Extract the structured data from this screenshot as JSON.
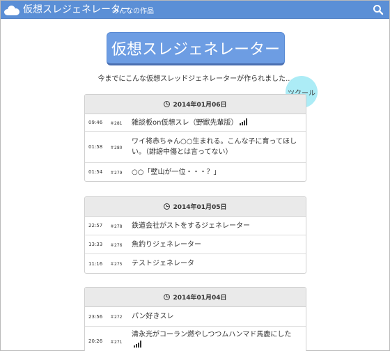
{
  "nav": {
    "brand": "仮想スレジェネレーター",
    "link": "みんなの作品"
  },
  "hero": {
    "button_label": "仮想スレジェネレーター",
    "subtitle": "今までにこんな仮想スレッドジェネレーターが作られました...",
    "create_label": "ツクール"
  },
  "panels": [
    {
      "date": "2014年01月06日",
      "rows": [
        {
          "time": "09:46",
          "num": "＃281",
          "title": "雑談板on仮想スレ（野獣先輩版）",
          "signal": true
        },
        {
          "time": "01:58",
          "num": "＃280",
          "title": "ワイ将赤ちゃん○○生まれる。こんな子に育ってほしい。（誹謗中傷とは言ってない）",
          "signal": false
        },
        {
          "time": "01:54",
          "num": "＃279",
          "title": "○○「壁山が一位・・・？」",
          "signal": false
        }
      ]
    },
    {
      "date": "2014年01月05日",
      "rows": [
        {
          "time": "22:57",
          "num": "＃278",
          "title": "鉄道会社がストをするジェネレーター",
          "signal": false
        },
        {
          "time": "13:33",
          "num": "＃276",
          "title": "魚釣りジェネレーター",
          "signal": false
        },
        {
          "time": "11:16",
          "num": "＃275",
          "title": "テストジェネレータ",
          "signal": false
        }
      ]
    },
    {
      "date": "2014年01月04日",
      "rows": [
        {
          "time": "23:56",
          "num": "＃272",
          "title": "パン好きスレ",
          "signal": false
        },
        {
          "time": "20:26",
          "num": "＃271",
          "title": "清永光がコーラン燃やしつつムハンマド馬鹿にした",
          "signal": true
        }
      ]
    }
  ],
  "colors": {
    "navbar": "#5b8fd6",
    "hero": "#6d9de3",
    "create_bubble": "#a8ecf6"
  },
  "icons": [
    "cloud-icon",
    "search-icon",
    "clock-icon",
    "signal-icon"
  ]
}
